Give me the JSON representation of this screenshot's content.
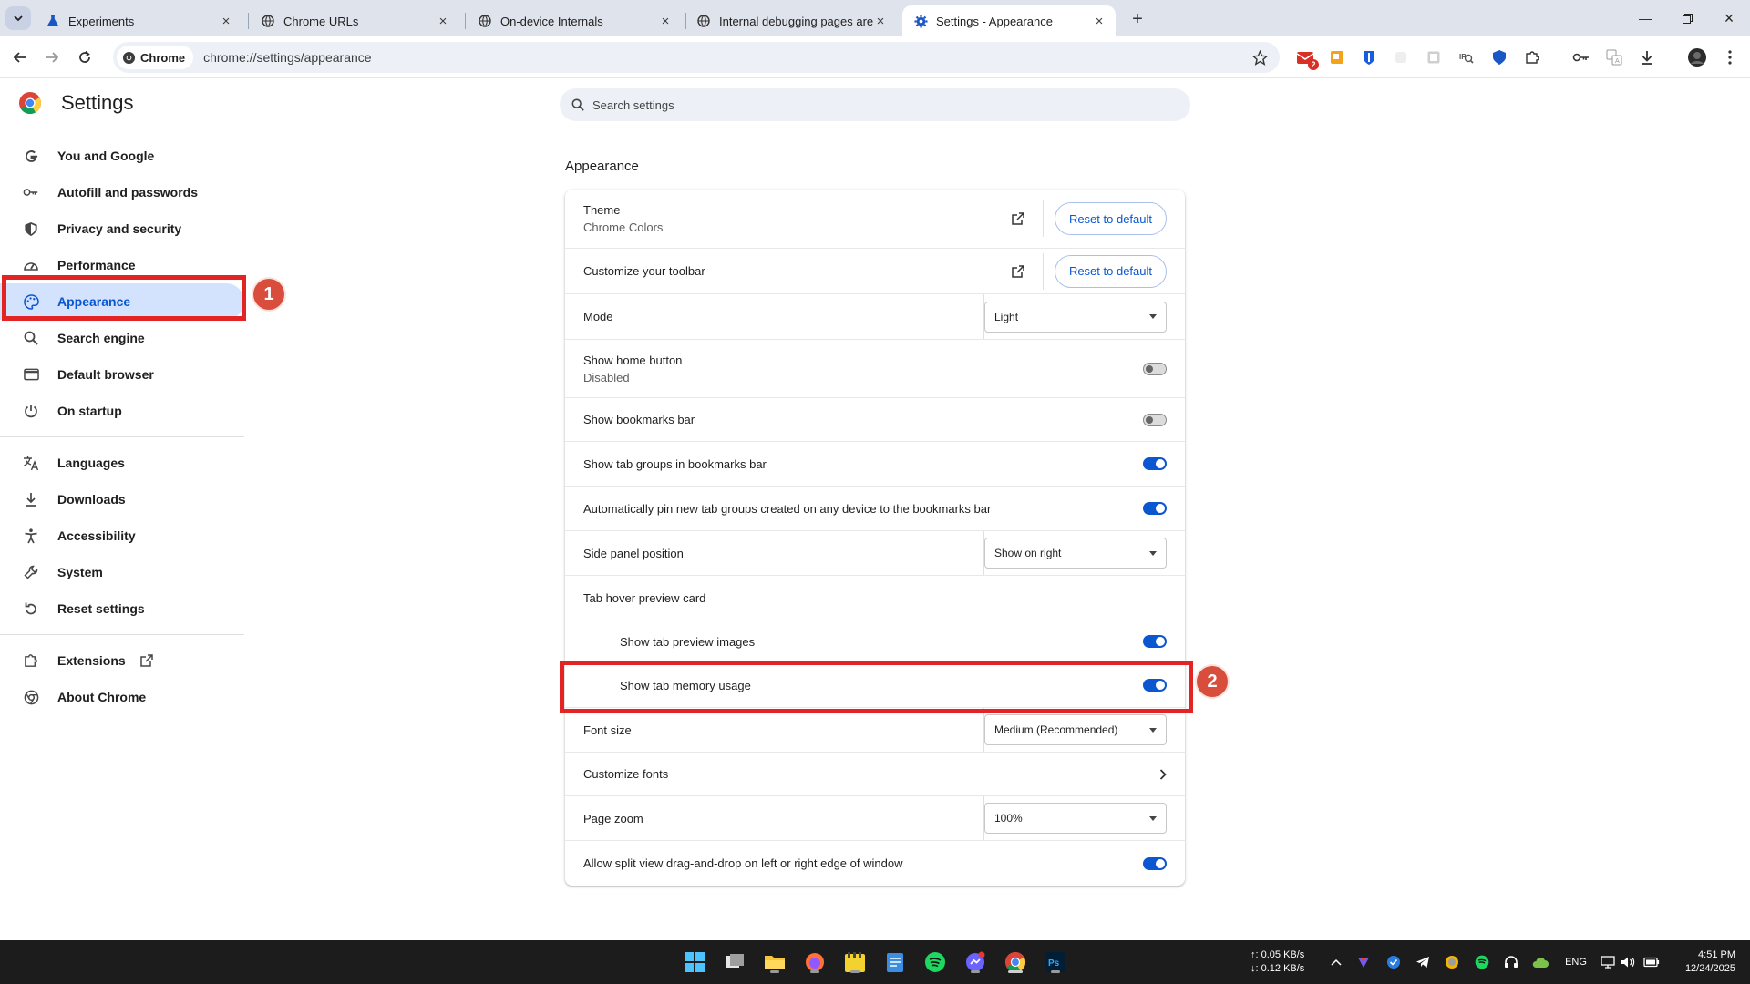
{
  "tabs": [
    {
      "title": "Experiments",
      "icon": "flask-icon"
    },
    {
      "title": "Chrome URLs",
      "icon": "globe-icon"
    },
    {
      "title": "On-device Internals",
      "icon": "globe-icon"
    },
    {
      "title": "Internal debugging pages are c",
      "icon": "globe-icon"
    },
    {
      "title": "Settings - Appearance",
      "icon": "gear-icon",
      "active": true
    }
  ],
  "toolbar": {
    "chip_label": "Chrome",
    "url": "chrome://settings/appearance",
    "extension_badge": "2"
  },
  "settings": {
    "title": "Settings",
    "menu": [
      {
        "label": "You and Google",
        "icon": "google-g-icon"
      },
      {
        "label": "Autofill and passwords",
        "icon": "key-icon"
      },
      {
        "label": "Privacy and security",
        "icon": "shield-icon"
      },
      {
        "label": "Performance",
        "icon": "speedometer-icon"
      },
      {
        "label": "Appearance",
        "icon": "palette-icon",
        "selected": true
      },
      {
        "label": "Search engine",
        "icon": "search-icon"
      },
      {
        "label": "Default browser",
        "icon": "browser-window-icon"
      },
      {
        "label": "On startup",
        "icon": "power-icon"
      }
    ],
    "menu2": [
      {
        "label": "Languages",
        "icon": "translate-icon"
      },
      {
        "label": "Downloads",
        "icon": "download-icon"
      },
      {
        "label": "Accessibility",
        "icon": "accessibility-icon"
      },
      {
        "label": "System",
        "icon": "wrench-icon"
      },
      {
        "label": "Reset settings",
        "icon": "reset-icon"
      }
    ],
    "menu3": [
      {
        "label": "Extensions",
        "icon": "puzzle-icon"
      },
      {
        "label": "About Chrome",
        "icon": "chrome-icon"
      }
    ]
  },
  "search": {
    "placeholder": "Search settings"
  },
  "appearance": {
    "section_title": "Appearance",
    "theme_label": "Theme",
    "theme_value": "Chrome Colors",
    "reset_label": "Reset to default",
    "toolbar_label": "Customize your toolbar",
    "mode_label": "Mode",
    "mode_value": "Light",
    "home_label": "Show home button",
    "home_value": "Disabled",
    "bookmarks_label": "Show bookmarks bar",
    "tabgroups_label": "Show tab groups in bookmarks bar",
    "autopin_label": "Automatically pin new tab groups created on any device to the bookmarks bar",
    "sidepanel_label": "Side panel position",
    "sidepanel_value": "Show on right",
    "hovercard_label": "Tab hover preview card",
    "preview_images_label": "Show tab preview images",
    "memory_label": "Show tab memory usage",
    "fontsize_label": "Font size",
    "fontsize_value": "Medium (Recommended)",
    "customfonts_label": "Customize fonts",
    "zoom_label": "Page zoom",
    "zoom_value": "100%",
    "splitview_label": "Allow split view drag-and-drop on left or right edge of window",
    "toggles": {
      "home": false,
      "bookmarks": false,
      "tabgroups": true,
      "autopin": true,
      "preview_images": true,
      "memory": true,
      "splitview": true
    }
  },
  "annotations": {
    "callout_1": "1",
    "callout_2": "2"
  },
  "taskbar": {
    "net_up": "↑: 0.05 KB/s",
    "net_down": "↓: 0.12 KB/s",
    "lang": "ENG",
    "time": "4:51 PM",
    "date": "12/24/2025"
  },
  "colors": {
    "accent": "#0b57d0",
    "selected_bg": "#d3e3fd",
    "highlight": "#e22424",
    "callout": "#d94d3c"
  }
}
